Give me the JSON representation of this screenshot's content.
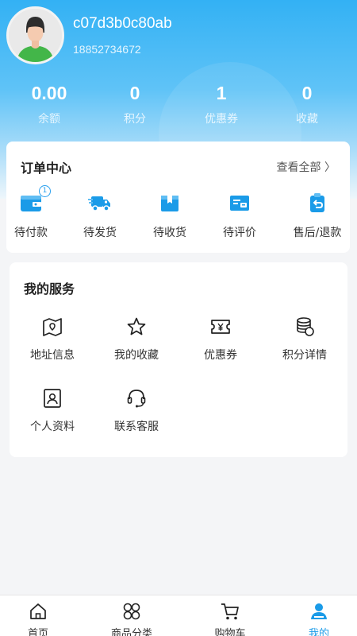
{
  "user": {
    "name": "c07d3b0c80ab",
    "phone": "18852734672"
  },
  "stats": [
    {
      "value": "0.00",
      "label": "余额"
    },
    {
      "value": "0",
      "label": "积分"
    },
    {
      "value": "1",
      "label": "优惠券"
    },
    {
      "value": "0",
      "label": "收藏"
    }
  ],
  "orders": {
    "title": "订单中心",
    "view_all": "查看全部 〉",
    "items": [
      {
        "label": "待付款",
        "icon": "wallet-icon",
        "badge": "1"
      },
      {
        "label": "待发货",
        "icon": "truck-icon"
      },
      {
        "label": "待收货",
        "icon": "package-icon"
      },
      {
        "label": "待评价",
        "icon": "review-icon"
      },
      {
        "label": "售后/退款",
        "icon": "return-icon"
      }
    ]
  },
  "services": {
    "title": "我的服务",
    "items": [
      {
        "label": "地址信息",
        "icon": "map-icon"
      },
      {
        "label": "我的收藏",
        "icon": "star-icon"
      },
      {
        "label": "优惠券",
        "icon": "coupon-icon"
      },
      {
        "label": "积分详情",
        "icon": "coins-icon"
      },
      {
        "label": "个人资料",
        "icon": "profile-icon"
      },
      {
        "label": "联系客服",
        "icon": "headset-icon"
      }
    ]
  },
  "tabbar": {
    "items": [
      {
        "label": "首页",
        "icon": "home-icon"
      },
      {
        "label": "商品分类",
        "icon": "category-icon"
      },
      {
        "label": "购物车",
        "icon": "cart-icon"
      },
      {
        "label": "我的",
        "icon": "user-icon",
        "active": true
      }
    ]
  },
  "colors": {
    "primary": "#1a9be8",
    "header_top": "#33b1f4",
    "page_bg": "#f4f5f7"
  }
}
